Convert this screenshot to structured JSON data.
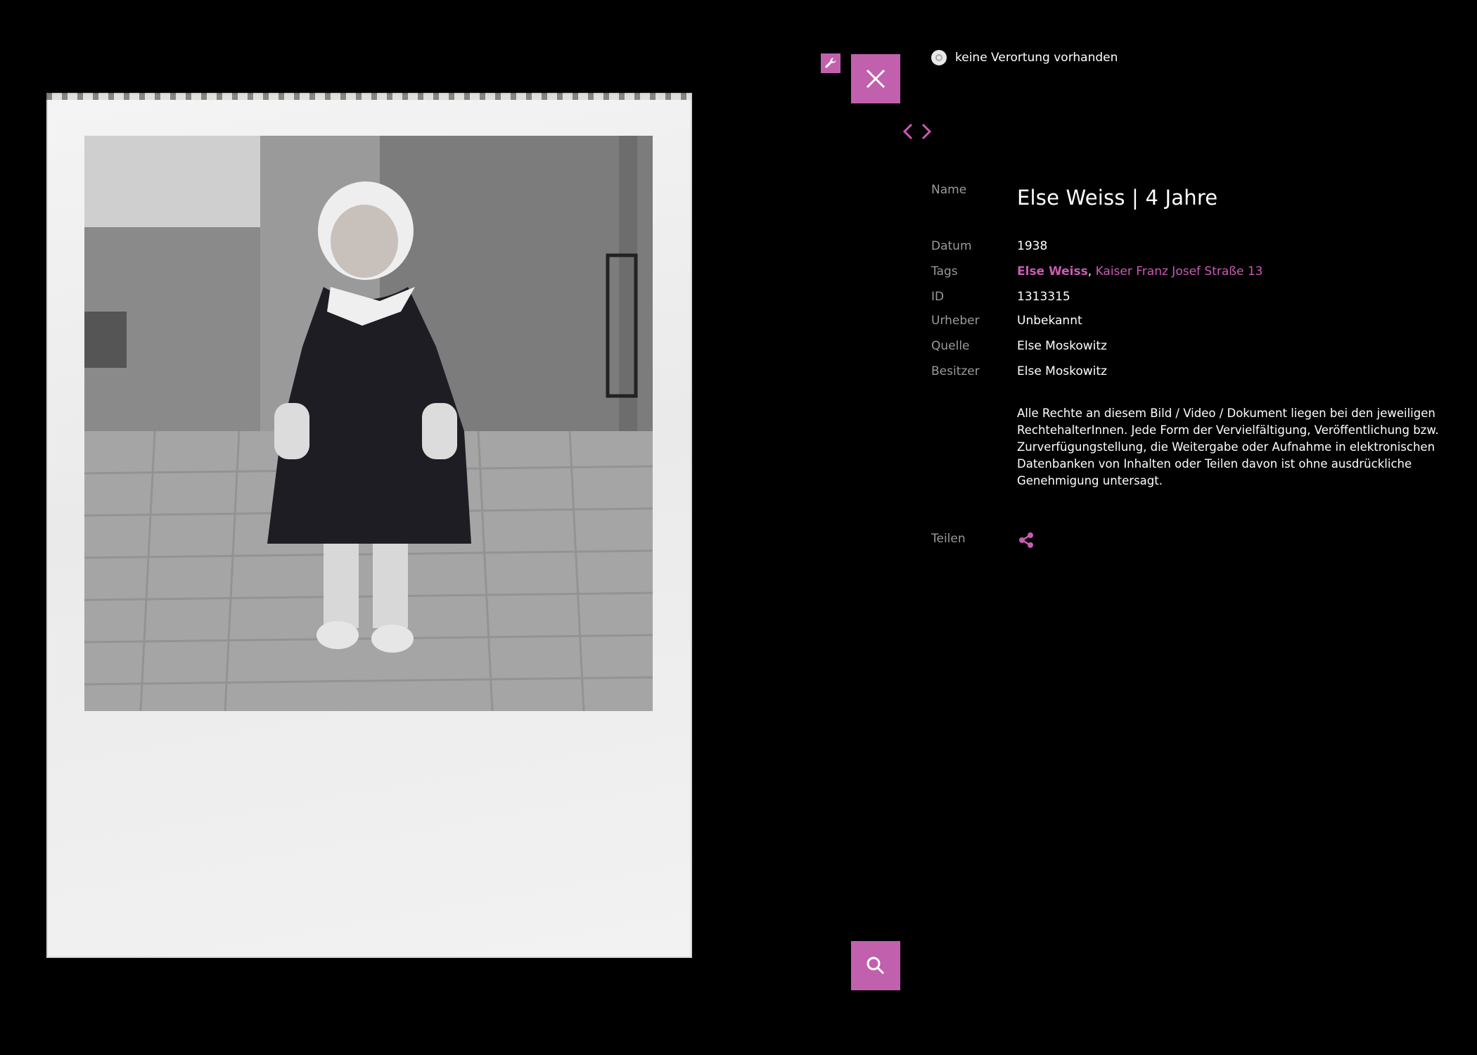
{
  "location": {
    "status_text": "keine Verortung vorhanden"
  },
  "photo": {
    "alt": "Schwarz-Weiß-Foto eines kleinen Mädchens in Mantel und Mütze"
  },
  "details": {
    "name_label": "Name",
    "name_value": "Else Weiss | 4 Jahre",
    "date_label": "Datum",
    "date_value": "1938",
    "tags_label": "Tags",
    "tags": [
      {
        "label": "Else Weiss"
      },
      {
        "label": "Kaiser Franz Josef Straße 13"
      }
    ],
    "tag_separator": ",",
    "id_label": "ID",
    "id_value": "1313315",
    "author_label": "Urheber",
    "author_value": "Unbekannt",
    "source_label": "Quelle",
    "source_value": "Else Moskowitz",
    "owner_label": "Besitzer",
    "owner_value": "Else Moskowitz",
    "rights_text": "Alle Rechte an diesem Bild / Video / Dokument liegen bei den jeweiligen RechtehalterInnen. Jede Form der Vervielfältigung, Veröffentlichung bzw. Zurverfügungstellung, die Weitergabe oder Aufnahme in elektronischen Datenbanken von Inhalten oder Teilen davon ist ohne ausdrückliche Genehmigung untersagt.",
    "share_label": "Teilen"
  },
  "icons": {
    "tool": "wrench-icon",
    "close": "close-icon",
    "prev": "chevron-left-icon",
    "next": "chevron-right-icon",
    "share": "share-icon",
    "search": "search-icon",
    "location": "location-dot-icon"
  },
  "colors": {
    "accent": "#c160ad",
    "link": "#c95bb3",
    "background": "#000000",
    "label": "#9a9a9a",
    "text": "#ffffff"
  }
}
